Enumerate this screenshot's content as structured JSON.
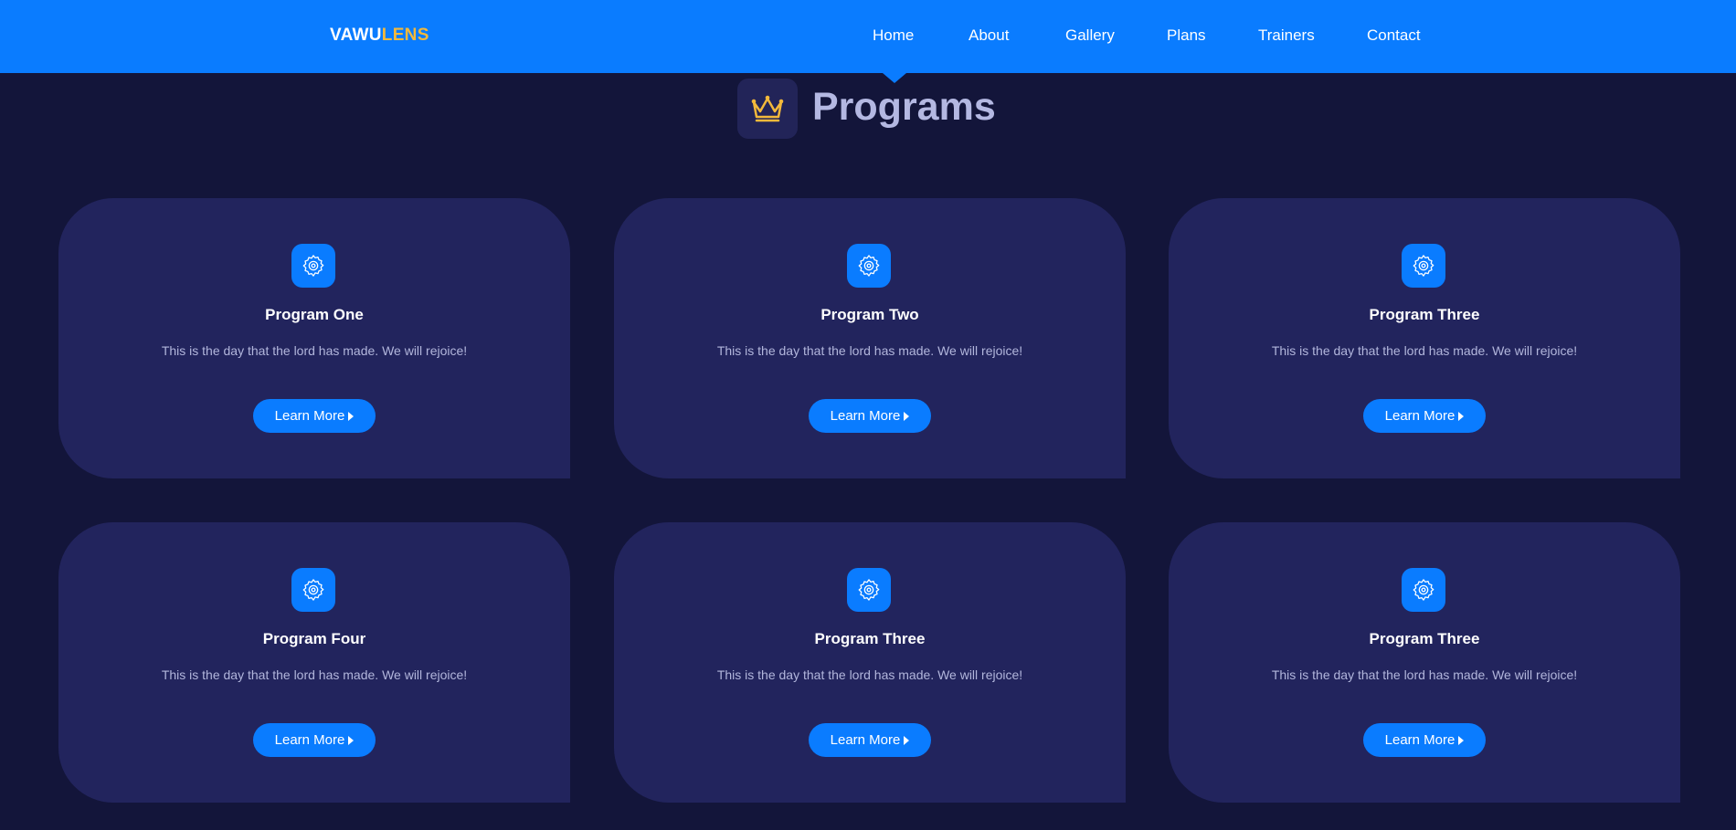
{
  "brand": {
    "logo_main": "VAWU",
    "logo_accent": "LENS"
  },
  "nav": {
    "items": [
      {
        "label": "Home",
        "active": true
      },
      {
        "label": "About"
      },
      {
        "label": "Gallery"
      },
      {
        "label": "Plans"
      },
      {
        "label": "Trainers"
      },
      {
        "label": "Contact"
      }
    ]
  },
  "section": {
    "title": "Programs",
    "icon": "crown-icon"
  },
  "cards": [
    {
      "title": "Program One",
      "text": "This is the day that the lord has made. We will rejoice!",
      "button": "Learn More",
      "icon": "gear-icon"
    },
    {
      "title": "Program Two",
      "text": "This is the day that the lord has made. We will rejoice!",
      "button": "Learn More",
      "icon": "gear-icon"
    },
    {
      "title": "Program Three",
      "text": "This is the day that the lord has made. We will rejoice!",
      "button": "Learn More",
      "icon": "gear-icon"
    },
    {
      "title": "Program Four",
      "text": "This is the day that the lord has made. We will rejoice!",
      "button": "Learn More",
      "icon": "gear-icon"
    },
    {
      "title": "Program Three",
      "text": "This is the day that the lord has made. We will rejoice!",
      "button": "Learn More",
      "icon": "gear-icon"
    },
    {
      "title": "Program Three",
      "text": "This is the day that the lord has made. We will rejoice!",
      "button": "Learn More",
      "icon": "gear-icon"
    }
  ],
  "colors": {
    "primary": "#0a7cff",
    "background": "#13153a",
    "card": "#22245d",
    "logo_accent": "#f3b93b",
    "heading": "#b4b8e2"
  }
}
